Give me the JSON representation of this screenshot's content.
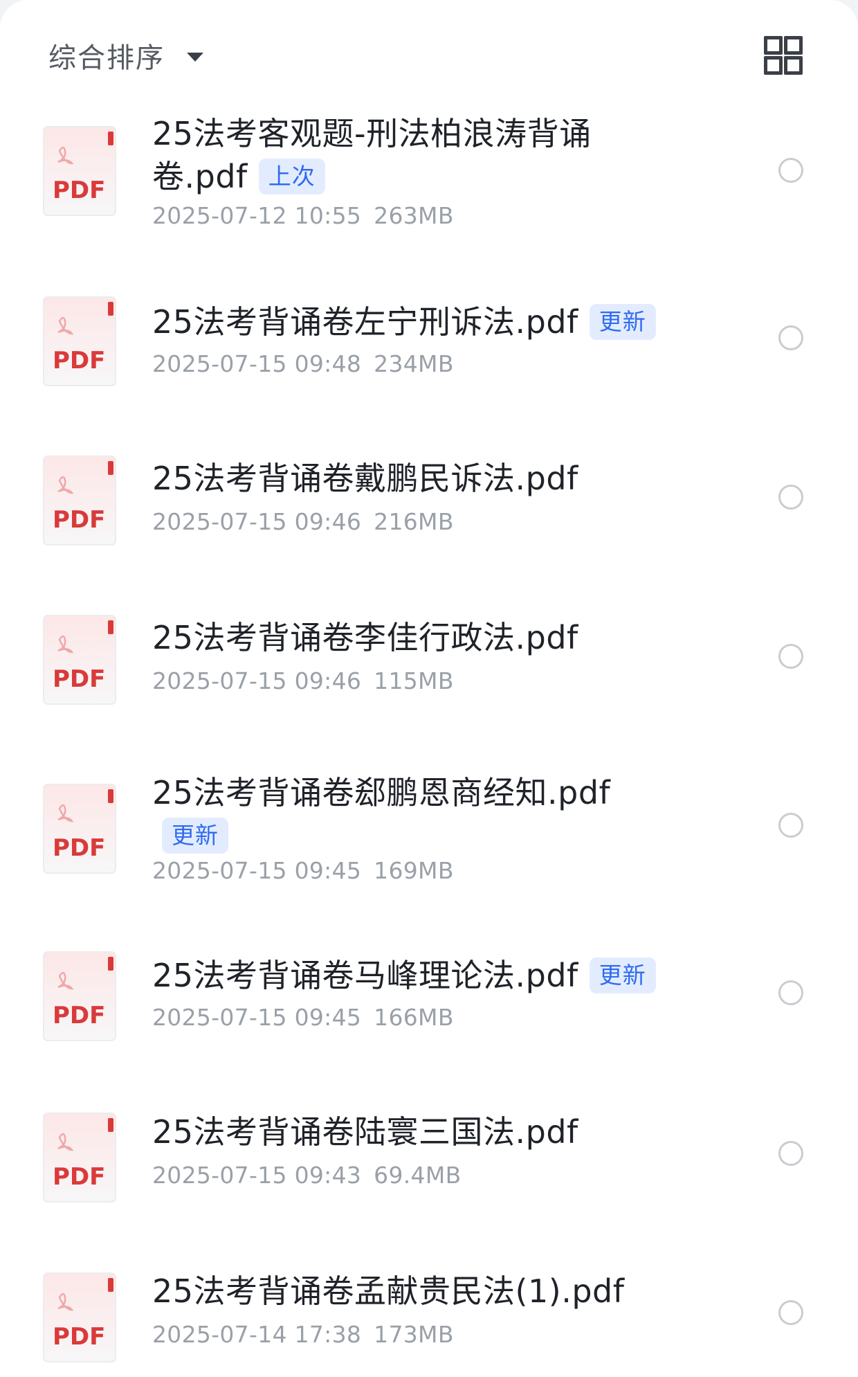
{
  "toolbar": {
    "sort_label": "综合排序",
    "sort_icon": "caret-down-icon",
    "view_toggle_icon": "grid-view-icon"
  },
  "files": [
    {
      "title_line1": "25法考客观题-刑法柏浪涛背诵",
      "title_line2": "卷.pdf",
      "badge": "上次",
      "date": "2025-07-12 10:55",
      "size": "263MB",
      "icon": "pdf-file-icon"
    },
    {
      "title": "25法考背诵卷左宁刑诉法.pdf",
      "badge": "更新",
      "date": "2025-07-15 09:48",
      "size": "234MB",
      "icon": "pdf-file-icon"
    },
    {
      "title": "25法考背诵卷戴鹏民诉法.pdf",
      "date": "2025-07-15 09:46",
      "size": "216MB",
      "icon": "pdf-file-icon"
    },
    {
      "title": "25法考背诵卷李佳行政法.pdf",
      "date": "2025-07-15 09:46",
      "size": "115MB",
      "icon": "pdf-file-icon"
    },
    {
      "title": "25法考背诵卷郄鹏恩商经知.pdf",
      "badge": "更新",
      "date": "2025-07-15 09:45",
      "size": "169MB",
      "icon": "pdf-file-icon"
    },
    {
      "title": "25法考背诵卷马峰理论法.pdf",
      "badge": "更新",
      "date": "2025-07-15 09:45",
      "size": "166MB",
      "icon": "pdf-file-icon"
    },
    {
      "title": "25法考背诵卷陆寰三国法.pdf",
      "date": "2025-07-15 09:43",
      "size": "69.4MB",
      "icon": "pdf-file-icon"
    },
    {
      "title": "25法考背诵卷孟献贵民法(1).pdf",
      "date": "2025-07-14 17:38",
      "size": "173MB",
      "icon": "pdf-file-icon"
    }
  ],
  "pdf_icon_label": "PDF",
  "colors": {
    "pdf_red": "#d93a3a",
    "badge_bg": "#e3ecff",
    "badge_text": "#2f6bf0",
    "title_text": "#1f2329",
    "meta_text": "#9aa0a8"
  }
}
